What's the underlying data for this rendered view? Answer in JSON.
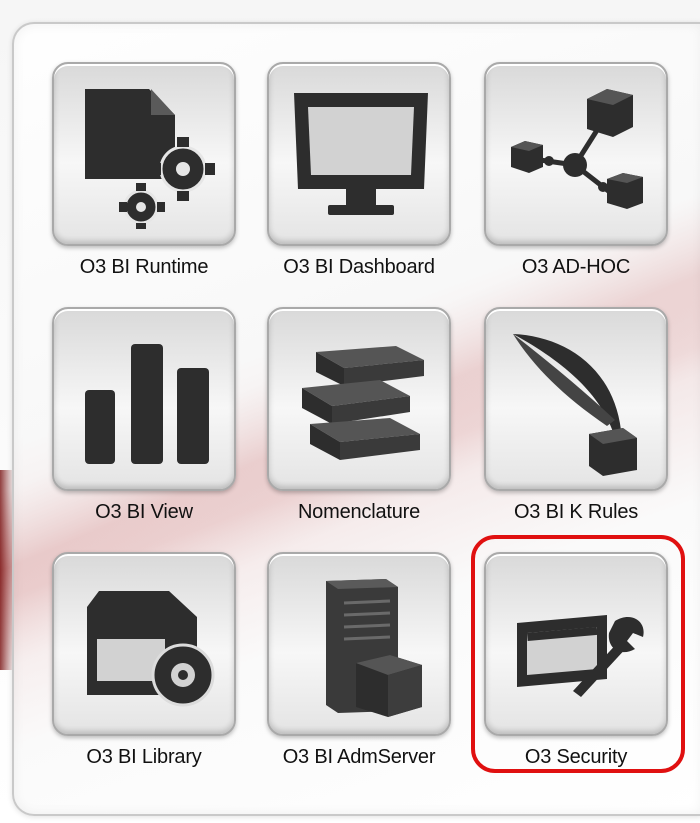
{
  "tiles": [
    {
      "label": "O3 BI Runtime",
      "icon": "document-gears-icon"
    },
    {
      "label": "O3 BI Dashboard",
      "icon": "monitor-icon"
    },
    {
      "label": "O3 AD-HOC",
      "icon": "network-cubes-icon"
    },
    {
      "label": "O3 BI View",
      "icon": "bar-chart-icon"
    },
    {
      "label": "Nomenclature",
      "icon": "books-stack-icon"
    },
    {
      "label": "O3 BI K Rules",
      "icon": "quill-inkpot-icon"
    },
    {
      "label": "O3 BI Library",
      "icon": "library-disc-icon"
    },
    {
      "label": "O3 BI AdmServer",
      "icon": "server-box-icon"
    },
    {
      "label": "O3 Security",
      "icon": "screen-wrench-icon"
    }
  ],
  "highlight_color": "#e01010",
  "icon_color": "#2a2a2a"
}
